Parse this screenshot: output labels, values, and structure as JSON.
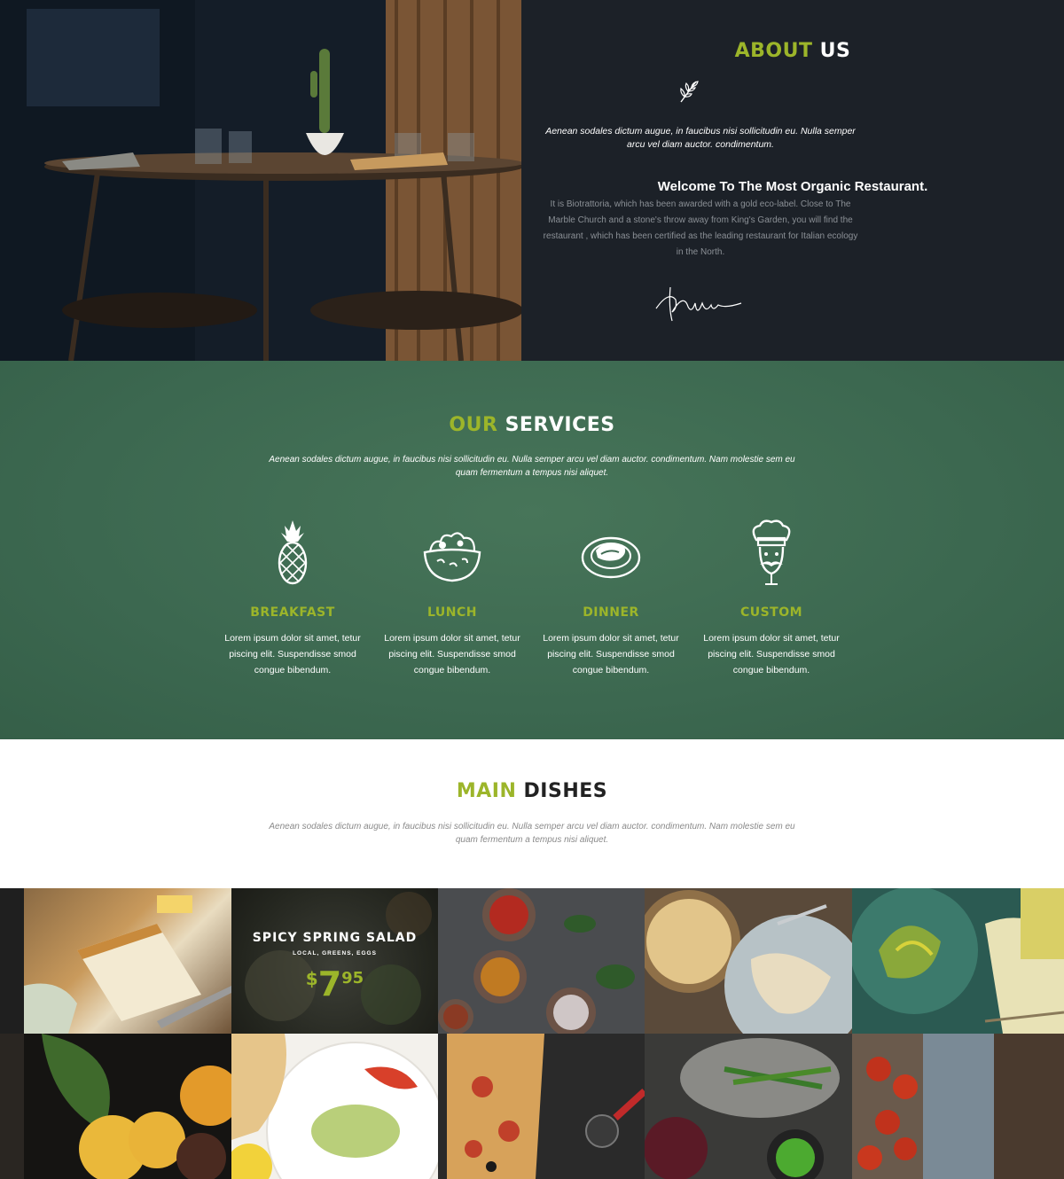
{
  "colors": {
    "accent": "#9cb52a",
    "dark_bg": "#1c2128",
    "green_bg": "#3e6a52"
  },
  "about": {
    "title_accent": "ABOUT",
    "title_rest": " US",
    "intro": "Aenean sodales dictum augue, in faucibus nisi sollicitudin eu. Nulla semper arcu vel diam auctor. condimentum.",
    "welcome": "Welcome To The Most Organic Restaurant.",
    "body": "It is Biotrattoria, which has been awarded with a gold eco-label. Close to The Marble Church and a stone's throw away from King's Garden, you will find the restaurant , which has been certified as the leading restaurant for Italian ecology in the North.",
    "icon": "leaf-icon"
  },
  "services": {
    "title_accent": "OUR",
    "title_rest": " SERVICES",
    "intro": "Aenean sodales dictum augue, in faucibus nisi sollicitudin eu. Nulla semper arcu vel diam auctor. condimentum. Nam molestie sem eu quam fermentum a tempus nisi aliquet.",
    "items": [
      {
        "name": "BREAKFAST",
        "icon": "pineapple-icon",
        "desc": "Lorem ipsum dolor sit amet, tetur piscing elit. Suspendisse smod congue bibendum."
      },
      {
        "name": "LUNCH",
        "icon": "salad-bowl-icon",
        "desc": "Lorem ipsum dolor sit amet, tetur piscing elit. Suspendisse smod congue bibendum."
      },
      {
        "name": "DINNER",
        "icon": "dinner-plate-icon",
        "desc": "Lorem ipsum dolor sit amet, tetur piscing elit. Suspendisse smod congue bibendum."
      },
      {
        "name": "CUSTOM",
        "icon": "chef-icon",
        "desc": "Lorem ipsum dolor sit amet, tetur piscing elit. Suspendisse smod congue bibendum."
      }
    ]
  },
  "dishes": {
    "title_accent": "MAIN",
    "title_rest": " DISHES",
    "intro": "Aenean sodales dictum augue, in faucibus nisi sollicitudin eu. Nulla semper arcu vel diam auctor. condimentum. Nam molestie sem eu quam fermentum a tempus nisi aliquet."
  },
  "promo": {
    "name": "SPICY SPRING SALAD",
    "tag": "LOCAL, GREENS, EGGS",
    "price_currency": "$",
    "price_main": "7",
    "price_cents": "95"
  }
}
